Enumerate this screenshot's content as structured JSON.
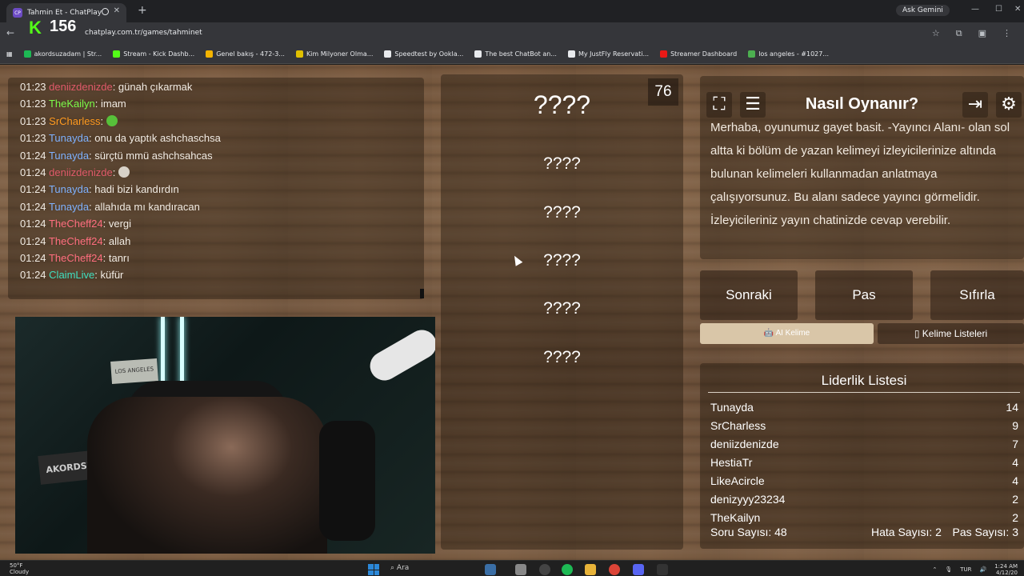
{
  "browser": {
    "tab_title": "Tahmin Et - ChatPlay",
    "tab_favicon": "CP",
    "ask_gemini": "Ask Gemini",
    "url": "chatplay.com.tr/games/tahminet",
    "bookmarks": [
      {
        "label": "akordsuzadam | Str...",
        "color": "#1db954"
      },
      {
        "label": "Stream - Kick Dashb...",
        "color": "#53fc18"
      },
      {
        "label": "Genel bakış - 472-3...",
        "color": "#f4b400"
      },
      {
        "label": "Kim Milyoner Olma...",
        "color": "#e0c000"
      },
      {
        "label": "Speedtest by Ookla...",
        "color": "#e8eaed"
      },
      {
        "label": "The best ChatBot an...",
        "color": "#e8eaed"
      },
      {
        "label": "My JustFly Reservati...",
        "color": "#e8eaed"
      },
      {
        "label": "Streamer Dashboard",
        "color": "#e91916"
      },
      {
        "label": "los angeles - #1027...",
        "color": "#4caf50"
      }
    ]
  },
  "overlay": {
    "kick_letter": "K",
    "viewer_count": "156"
  },
  "chat": {
    "messages": [
      {
        "time": "01:23",
        "user": "deniizdenizde",
        "color": "#e05a6a",
        "text": ": günah çıkarmak"
      },
      {
        "time": "01:23",
        "user": "TheKailyn",
        "color": "#7cfc4a",
        "text": ": imam"
      },
      {
        "time": "01:23",
        "user": "SrCharless",
        "color": "#ff9a1f",
        "text": ": ",
        "emote": "#57c03a"
      },
      {
        "time": "01:23",
        "user": "Tunayda",
        "color": "#7fb2ff",
        "text": ": onu da yaptık ashchaschsa"
      },
      {
        "time": "01:24",
        "user": "Tunayda",
        "color": "#7fb2ff",
        "text": ": sürçtü mmü ashchsahcas"
      },
      {
        "time": "01:24",
        "user": "deniizdenizde",
        "color": "#e05a6a",
        "text": ": ",
        "emote": "#d8d2c8"
      },
      {
        "time": "01:24",
        "user": "Tunayda",
        "color": "#7fb2ff",
        "text": ": hadi bizi kandırdın"
      },
      {
        "time": "01:24",
        "user": "Tunayda",
        "color": "#7fb2ff",
        "text": ": allahıda mı kandıracan"
      },
      {
        "time": "01:24",
        "user": "TheCheff24",
        "color": "#ff6e7f",
        "text": ": vergi"
      },
      {
        "time": "01:24",
        "user": "TheCheff24",
        "color": "#ff6e7f",
        "text": ": allah"
      },
      {
        "time": "01:24",
        "user": "TheCheff24",
        "color": "#ff6e7f",
        "text": ": tanrı"
      },
      {
        "time": "01:24",
        "user": "ClaimLive",
        "color": "#3fe0c0",
        "text": ": küfür"
      }
    ]
  },
  "webcam": {
    "sign_small": "LOS ANGELES",
    "sign_big": "AKORDSZ"
  },
  "game": {
    "timer": "76",
    "main_word": "????",
    "hidden_words": [
      "????",
      "????",
      "????",
      "????",
      "????"
    ]
  },
  "howto": {
    "title": "Nasıl Oynanır?",
    "text": "Merhaba, oyunumuz gayet basit. -Yayıncı Alanı- olan sol altta ki bölüm de yazan kelimeyi izleyicilerinize altında bulunan kelimeleri kullanmadan anlatmaya çalışıyorsunuz. Bu alanı sadece yayıncı görmelidir. İzleyicileriniz yayın chatinizde cevap verebilir."
  },
  "controls": {
    "next": "Sonraki",
    "pass": "Pas",
    "reset": "Sıfırla",
    "ai_word": "AI Kelime",
    "word_lists": "Kelime Listeleri"
  },
  "leaderboard": {
    "title": "Liderlik Listesi",
    "rows": [
      {
        "name": "Tunayda",
        "score": "14"
      },
      {
        "name": "SrCharless",
        "score": "9"
      },
      {
        "name": "deniizdenizde",
        "score": "7"
      },
      {
        "name": "HestiaTr",
        "score": "4"
      },
      {
        "name": "LikeAcircle",
        "score": "4"
      },
      {
        "name": "denizyyy23234",
        "score": "2"
      },
      {
        "name": "TheKailyn",
        "score": "2"
      }
    ]
  },
  "stats": {
    "questions": "Soru Sayısı: 48",
    "errors": "Hata Sayısı: 2",
    "passes": "Pas Sayısı: 3"
  },
  "taskbar": {
    "temp": "50°F",
    "weather": "Cloudy",
    "search": "Ara",
    "lang": "TUR",
    "time": "1:24 AM",
    "date": "4/12/20"
  },
  "colors": {
    "accent_green": "#53fc18",
    "ai_tab_bg": "#d9c6a8",
    "wood": "#7a5a3f"
  }
}
